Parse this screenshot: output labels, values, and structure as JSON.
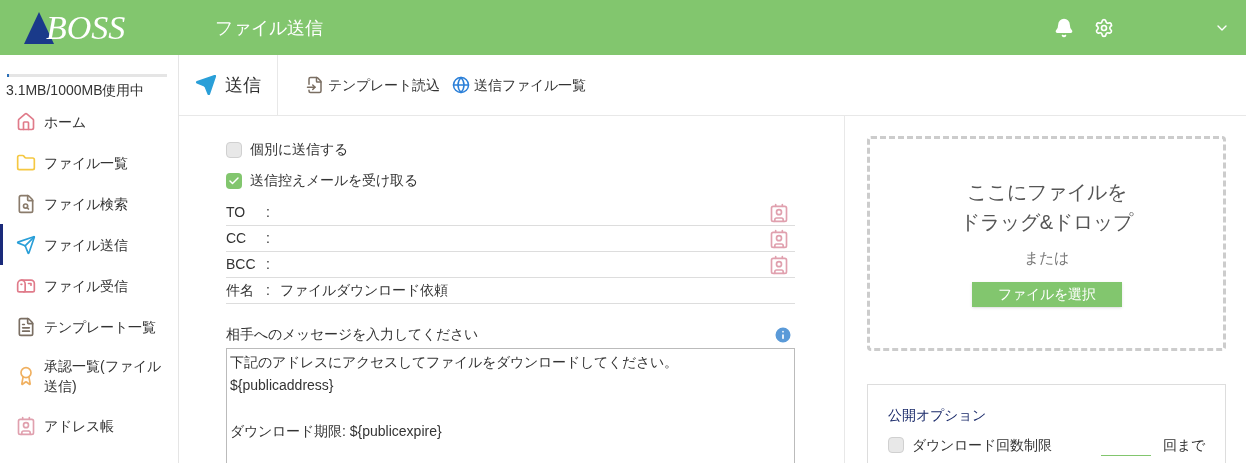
{
  "header": {
    "logo": "BOSS",
    "title": "ファイル送信"
  },
  "storage": {
    "level": 0.003,
    "reading": "3.1MB/1000MB使用中"
  },
  "sidebar": {
    "items": [
      {
        "label": "ホーム",
        "selected": false
      },
      {
        "label": "ファイル一覧",
        "selected": false
      },
      {
        "label": "ファイル検索",
        "selected": false
      },
      {
        "label": "ファイル送信",
        "selected": true
      },
      {
        "label": "ファイル受信",
        "selected": false
      },
      {
        "label": "テンプレート一覧",
        "selected": false
      },
      {
        "label": "承認一覧(ファイル送信)",
        "selected": false
      },
      {
        "label": "アドレス帳",
        "selected": false
      }
    ]
  },
  "toolbar": {
    "send": "送信",
    "actions": [
      "テンプレート読込",
      "送信ファイル一覧"
    ]
  },
  "form": {
    "options": [
      {
        "label": "個別に送信する",
        "checked": false
      },
      {
        "label": "送信控えメールを受け取る",
        "checked": true
      }
    ],
    "fields": [
      {
        "kind": "address",
        "label": "TO",
        "colon": ":"
      },
      {
        "kind": "address",
        "label": "CC",
        "colon": ":"
      },
      {
        "kind": "address",
        "label": "BCC",
        "colon": ":"
      },
      {
        "kind": "subject",
        "label": "件名",
        "colon": ":",
        "value": "ファイルダウンロード依頼"
      }
    ],
    "message_label": "相手へのメッセージを入力してください",
    "message": "下記のアドレスにアクセスしてファイルをダウンロードしてください。\n${publicaddress}\n\nダウンロード期限: ${publicexpire}"
  },
  "dropzone": {
    "lines": [
      "ここにファイルを",
      "ドラッグ&ドロップ"
    ],
    "or": "または",
    "button": "ファイルを選択"
  },
  "publish_options": {
    "title": "公開オプション",
    "items": [
      {
        "label": "ダウンロード回数制限",
        "checked": false,
        "suffix": "回まで"
      }
    ]
  }
}
